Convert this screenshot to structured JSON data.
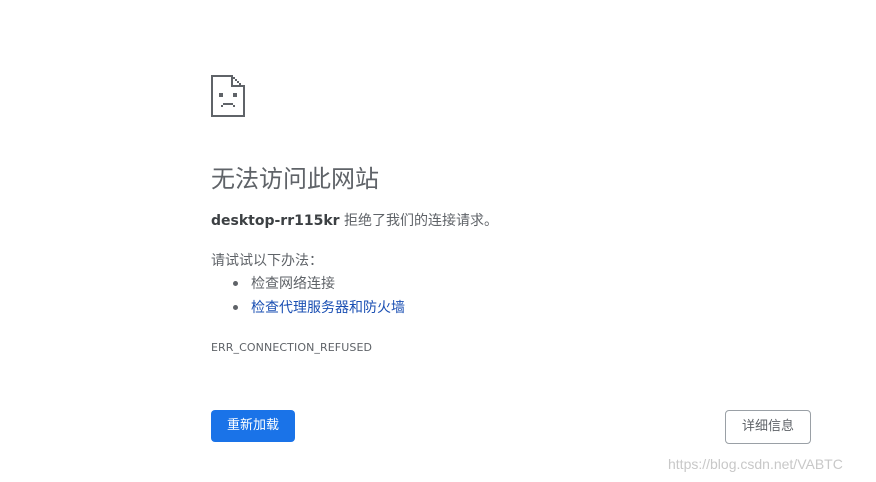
{
  "error_page": {
    "icon": "sad-page-icon",
    "title": "无法访问此网站",
    "summary_host": "desktop-rr115kr",
    "summary_rest": " 拒绝了我们的连接请求。",
    "try_label": "请试试以下办法：",
    "suggestions": [
      {
        "label": "检查网络连接",
        "is_link": false
      },
      {
        "label": "检查代理服务器和防火墙",
        "is_link": true
      }
    ],
    "error_code": "ERR_CONNECTION_REFUSED",
    "reload_label": "重新加载",
    "details_label": "详细信息"
  },
  "watermark": "https://blog.csdn.net/VABTC",
  "colors": {
    "primary_button": "#1a73e8",
    "link": "#1a4fb3",
    "text_secondary": "#5f6368"
  }
}
